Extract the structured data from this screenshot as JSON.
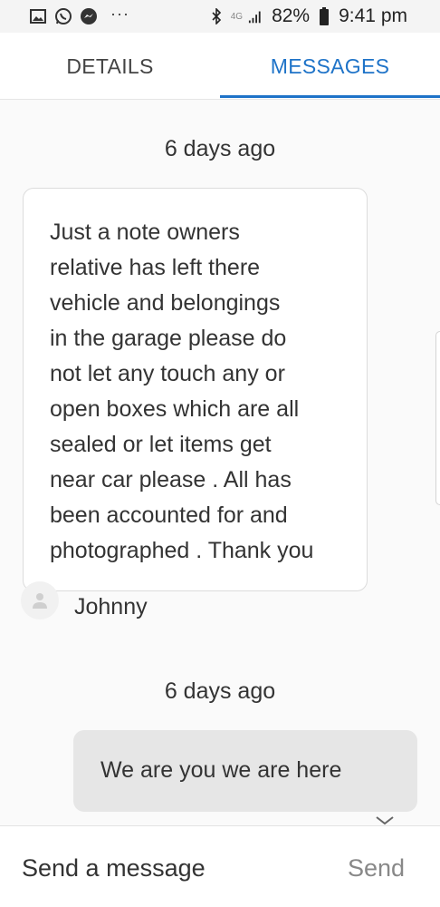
{
  "status_bar": {
    "left_icons": [
      "gallery-icon",
      "whatsapp-icon",
      "messenger-icon"
    ],
    "more": "···",
    "network": "4G",
    "battery": "82%",
    "time": "9:41 pm"
  },
  "tabs": [
    {
      "label": "DETAILS",
      "active": false
    },
    {
      "label": "MESSAGES",
      "active": true
    }
  ],
  "accent_color": "#1e73c8",
  "messages": [
    {
      "time": "6 days ago",
      "direction": "incoming",
      "text": "Just a note owners\nrelative has left there\nvehicle and belongings\nin the garage please do\nnot let any touch any or\nopen boxes which are all\nsealed or let items get\nnear car please . All has\nbeen accounted for and\nphotographed . Thank you",
      "sender": "Johnny"
    },
    {
      "time": "6 days ago",
      "direction": "outgoing",
      "text": "We are you we are here"
    }
  ],
  "composer": {
    "placeholder": "Send a message",
    "send_label": "Send"
  }
}
